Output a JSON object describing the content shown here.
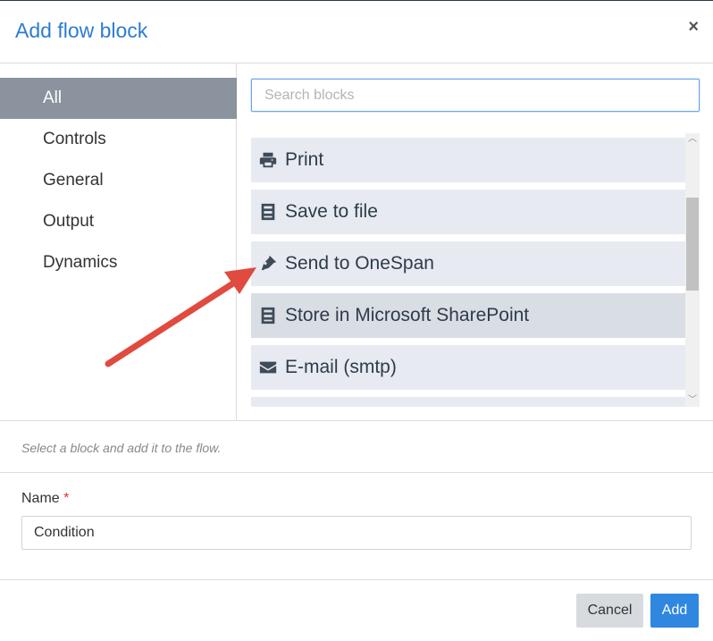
{
  "dialog": {
    "title": "Add flow block",
    "close_label": "×"
  },
  "categories": [
    {
      "label": "All",
      "active": true
    },
    {
      "label": "Controls",
      "active": false
    },
    {
      "label": "General",
      "active": false
    },
    {
      "label": "Output",
      "active": false
    },
    {
      "label": "Dynamics",
      "active": false
    }
  ],
  "search": {
    "placeholder": "Search blocks",
    "value": ""
  },
  "blocks": [
    {
      "label": "Print",
      "icon": "printer-icon"
    },
    {
      "label": "Save to file",
      "icon": "storage-icon"
    },
    {
      "label": "Send to OneSpan",
      "icon": "pen-nib-icon"
    },
    {
      "label": "Store in Microsoft SharePoint",
      "icon": "storage-icon"
    },
    {
      "label": "E-mail (smtp)",
      "icon": "envelope-icon"
    }
  ],
  "hint": "Select a block and add it to the flow.",
  "name_field": {
    "label": "Name",
    "required_mark": "*",
    "value": "Condition"
  },
  "buttons": {
    "cancel": "Cancel",
    "add": "Add"
  },
  "colors": {
    "accent": "#2b7cd3",
    "annotation_arrow": "#e04a3f",
    "active_category": "#8a939e",
    "block_bg": "#e7ebf1"
  }
}
